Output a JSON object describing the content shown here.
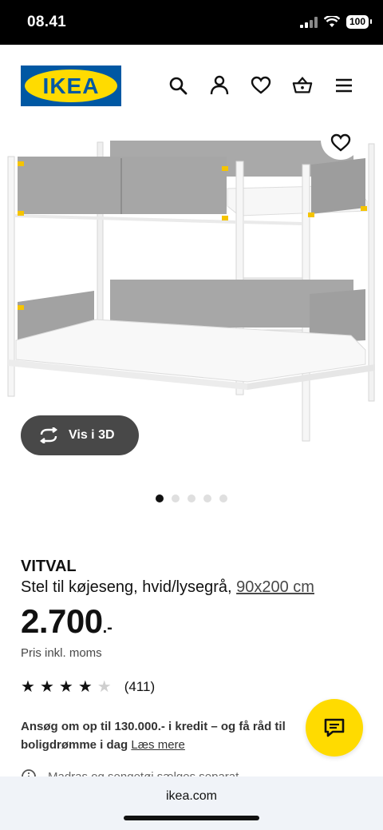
{
  "status_bar": {
    "time": "08.41",
    "battery": "100"
  },
  "header": {
    "logo_text": "IKEA",
    "icons": [
      "search-icon",
      "profile-icon",
      "heart-icon",
      "basket-icon",
      "menu-icon"
    ]
  },
  "gallery": {
    "view_3d_label": "Vis i 3D",
    "dots_count": 5,
    "active_dot": 1
  },
  "product": {
    "name": "VITVAL",
    "description": "Stel til køjeseng, hvid/lysegrå,",
    "size": "90x200 cm",
    "price": "2.700",
    "price_suffix": ".-",
    "vat_note": "Pris inkl. moms",
    "rating": 4.5,
    "review_count": "(411)"
  },
  "credit": {
    "text": "Ansøg om op til 130.000.- i kredit – og få råd til boligdrømme i dag",
    "link": "Læs mere"
  },
  "cutoff_text": "Madras og sengetøj sælges separat",
  "browser": {
    "url": "ikea.com"
  },
  "colors": {
    "ikea_blue": "#0058a3",
    "ikea_yellow": "#ffdb00",
    "dark_button": "#484848"
  }
}
